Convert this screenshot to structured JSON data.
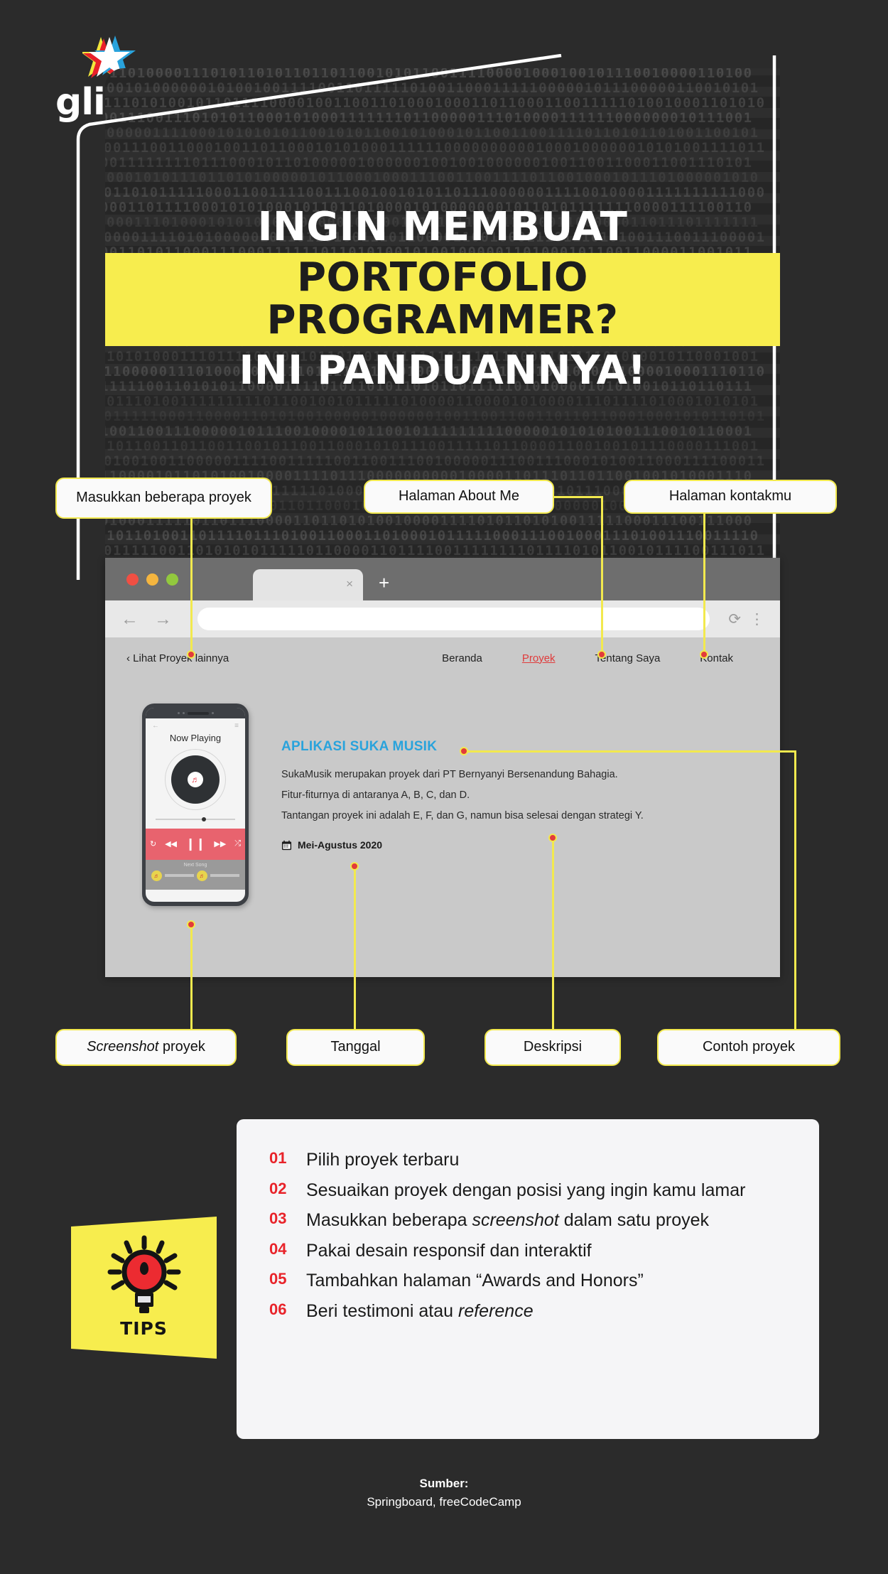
{
  "brand": {
    "name": "glints",
    "star_colors": {
      "white": "#ffffff",
      "red": "#e8202a",
      "yellow": "#f2e63c",
      "blue": "#29a3dc"
    }
  },
  "title": {
    "line1": "INGIN MEMBUAT",
    "line2_highlight": "PORTOFOLIO PROGRAMMER?",
    "line3": "INI PANDUANNYA!",
    "highlight_color": "#f7ed4e"
  },
  "callouts_top": [
    {
      "id": "callout-projects",
      "text": "Masukkan beberapa proyek"
    },
    {
      "id": "callout-about",
      "text": "Halaman About Me"
    },
    {
      "id": "callout-contact",
      "text": "Halaman kontakmu"
    }
  ],
  "callouts_bottom": [
    {
      "id": "callout-screenshot",
      "text_italic": "Screenshot",
      "text": " proyek"
    },
    {
      "id": "callout-date",
      "text": "Tanggal"
    },
    {
      "id": "callout-description",
      "text": "Deskripsi"
    },
    {
      "id": "callout-example",
      "text": "Contoh proyek"
    }
  ],
  "browser": {
    "tab_close": "×",
    "new_tab": "+",
    "back_arrow": "←",
    "forward_arrow": "→",
    "url_value": "",
    "url_placeholder": "",
    "reload": "⟳",
    "menu": "⋮"
  },
  "site": {
    "back_link": "‹ Lihat Proyek lainnya",
    "nav": [
      {
        "label": "Beranda",
        "active": false
      },
      {
        "label": "Proyek",
        "active": true
      },
      {
        "label": "Tentang Saya",
        "active": false
      },
      {
        "label": "Kontak",
        "active": false
      }
    ]
  },
  "phone": {
    "now_playing": "Now Playing",
    "back_icon": "←",
    "menu_icon": "≡",
    "note_icon": "♬",
    "repeat": "↻",
    "prev": "◀◀",
    "pause": "❙❙",
    "next": "▶▶",
    "shuffle": "⤮",
    "next_song_label": "Next Song"
  },
  "project": {
    "heading": "APLIKASI SUKA MUSIK",
    "accent_color": "#29a3dc",
    "paragraphs": [
      "SukaMusik merupakan proyek dari PT Bernyanyi Bersenandung Bahagia.",
      "Fitur-fiturnya di antaranya A, B, C, dan D.",
      "Tantangan proyek ini adalah E, F, dan G, namun bisa selesai dengan strategi Y."
    ],
    "date_icon": "calendar-icon",
    "date": "Mei-Agustus 2020"
  },
  "tips": {
    "badge_label": "TIPS",
    "badge_icon": "lightbulb-icon",
    "items": [
      {
        "num": "01",
        "text": "Pilih proyek terbaru"
      },
      {
        "num": "02",
        "text": "Sesuaikan proyek dengan posisi yang ingin kamu lamar"
      },
      {
        "num": "03",
        "text_pre": "Masukkan beberapa ",
        "text_italic": "screenshot",
        "text_post": " dalam satu proyek"
      },
      {
        "num": "04",
        "text": "Pakai desain responsif dan interaktif"
      },
      {
        "num": "05",
        "text": "Tambahkan halaman “Awards and Honors”"
      },
      {
        "num": "06",
        "text_pre": "Beri testimoni atau ",
        "text_italic": "reference",
        "text_post": ""
      }
    ]
  },
  "footer": {
    "label": "Sumber:",
    "sources": "Springboard, freeCodeCamp"
  }
}
